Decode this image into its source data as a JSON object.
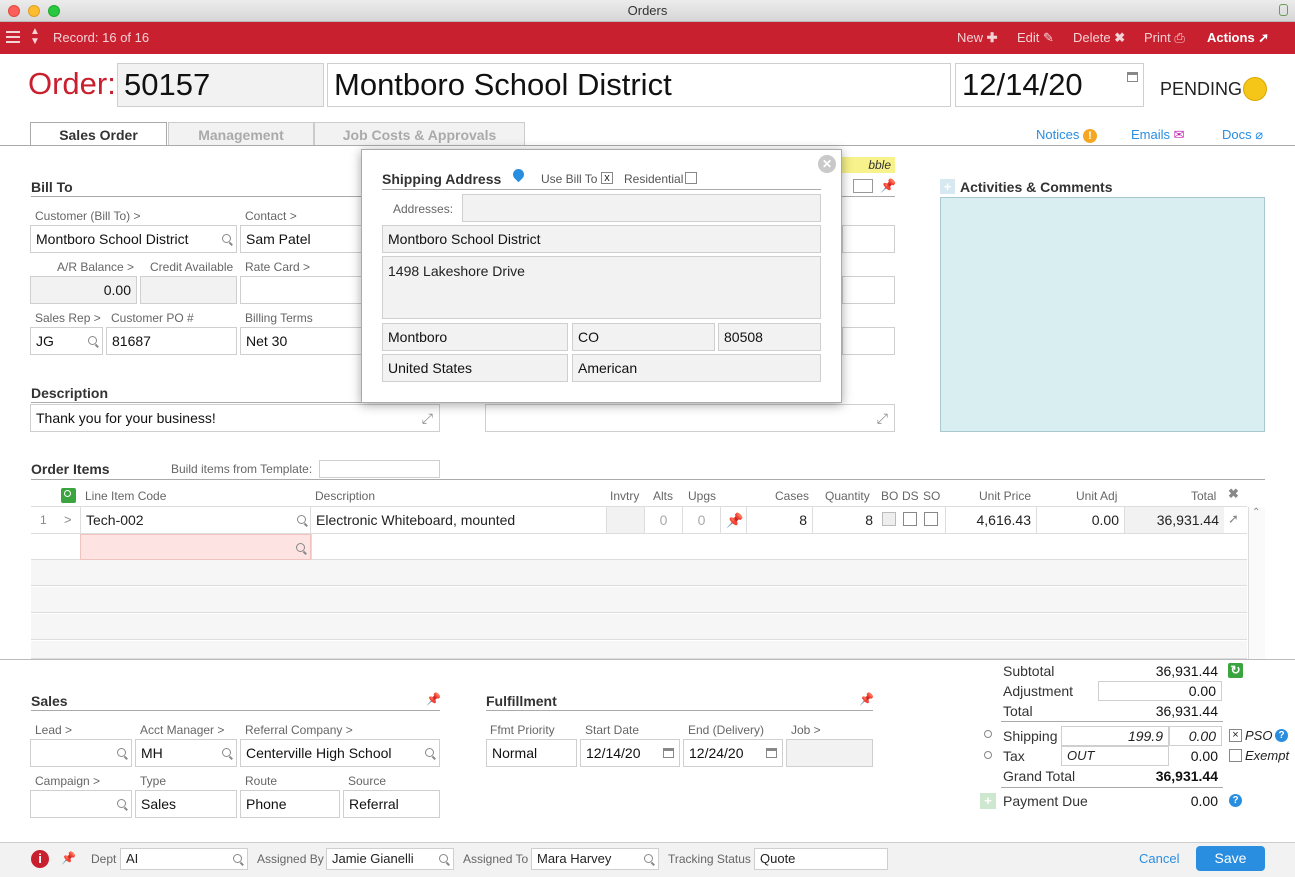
{
  "window": {
    "title": "Orders"
  },
  "toolbar": {
    "record": "Record: 16 of 16",
    "new": "New",
    "edit": "Edit",
    "delete": "Delete",
    "print": "Print",
    "actions": "Actions"
  },
  "order": {
    "label": "Order:",
    "number": "50157",
    "customer_name": "Montboro School District",
    "date": "12/14/20",
    "status": "PENDING",
    "status_color": "#f5c518"
  },
  "tabs": [
    "Sales Order",
    "Management",
    "Job Costs & Approvals"
  ],
  "header_links": {
    "notices": "Notices",
    "emails": "Emails",
    "docs": "Docs"
  },
  "bill_to": {
    "title": "Bill To",
    "customer_label": "Customer (Bill To) >",
    "customer": "Montboro School District",
    "contact_label": "Contact >",
    "contact": "Sam Patel",
    "ar_label": "A/R Balance >",
    "ar": "0.00",
    "credit_label": "Credit Available",
    "credit": "",
    "rate_label": "Rate Card >",
    "rate": "",
    "rep_label": "Sales Rep >",
    "rep": "JG",
    "po_label": "Customer PO #",
    "po": "81687",
    "terms_label": "Billing Terms",
    "terms": "Net 30"
  },
  "note_banner": "bble wrap!",
  "description": {
    "title": "Description",
    "value": "Thank you for your business!"
  },
  "activities": {
    "title": "Activities & Comments"
  },
  "shipping_popup": {
    "title": "Shipping Address",
    "use_bill_to": "Use Bill To",
    "use_bill_to_checked": "x",
    "residential": "Residential",
    "addresses_label": "Addresses:",
    "addresses": "",
    "name": "Montboro School District",
    "street": "1498 Lakeshore Drive",
    "city": "Montboro",
    "state": "CO",
    "zip": "80508",
    "country": "United States",
    "carrier": "American"
  },
  "order_items": {
    "title": "Order Items",
    "template_label": "Build items from Template:",
    "columns": [
      "Line Item Code",
      "Description",
      "Invtry",
      "Alts",
      "Upgs",
      "Cases",
      "Quantity",
      "BO",
      "DS",
      "SO",
      "Unit Price",
      "Unit Adj",
      "Total"
    ],
    "rows": [
      {
        "num": "1",
        "code": "Tech-002",
        "description": "Electronic Whiteboard, mounted",
        "invtry": "",
        "alts": "0",
        "upgs": "0",
        "cases": "8",
        "quantity": "8",
        "unit_price": "4,616.43",
        "unit_adj": "0.00",
        "total": "36,931.44"
      }
    ]
  },
  "sales": {
    "title": "Sales",
    "lead_label": "Lead >",
    "lead": "",
    "acct_label": "Acct Manager >",
    "acct": "MH",
    "referral_label": "Referral Company >",
    "referral": "Centerville High School",
    "campaign_label": "Campaign >",
    "campaign": "",
    "type_label": "Type",
    "type": "Sales",
    "route_label": "Route",
    "route": "Phone",
    "source_label": "Source",
    "source": "Referral"
  },
  "fulfillment": {
    "title": "Fulfillment",
    "priority_label": "Ffmt Priority",
    "priority": "Normal",
    "start_label": "Start Date",
    "start": "12/14/20",
    "end_label": "End (Delivery)",
    "end": "12/24/20",
    "job_label": "Job >",
    "job": ""
  },
  "totals": {
    "subtotal_label": "Subtotal",
    "subtotal": "36,931.44",
    "adjustment_label": "Adjustment",
    "adjustment": "0.00",
    "total_label": "Total",
    "total": "36,931.44",
    "shipping_label": "Shipping",
    "shipping_est": "199.9",
    "shipping": "0.00",
    "pso": "PSO",
    "tax_label": "Tax",
    "tax_code": "OUT",
    "tax": "0.00",
    "exempt": "Exempt",
    "grand_label": "Grand Total",
    "grand": "36,931.44",
    "due_label": "Payment Due",
    "due": "0.00"
  },
  "footer": {
    "dept_label": "Dept",
    "dept": "AI",
    "assigned_by_label": "Assigned By",
    "assigned_by": "Jamie Gianelli",
    "assigned_to_label": "Assigned To",
    "assigned_to": "Mara Harvey",
    "tracking_label": "Tracking Status",
    "tracking": "Quote",
    "cancel": "Cancel",
    "save": "Save"
  },
  "colors": {
    "brand": "#c8202f",
    "link": "#2a8ee0",
    "save": "#2a8ee0"
  }
}
